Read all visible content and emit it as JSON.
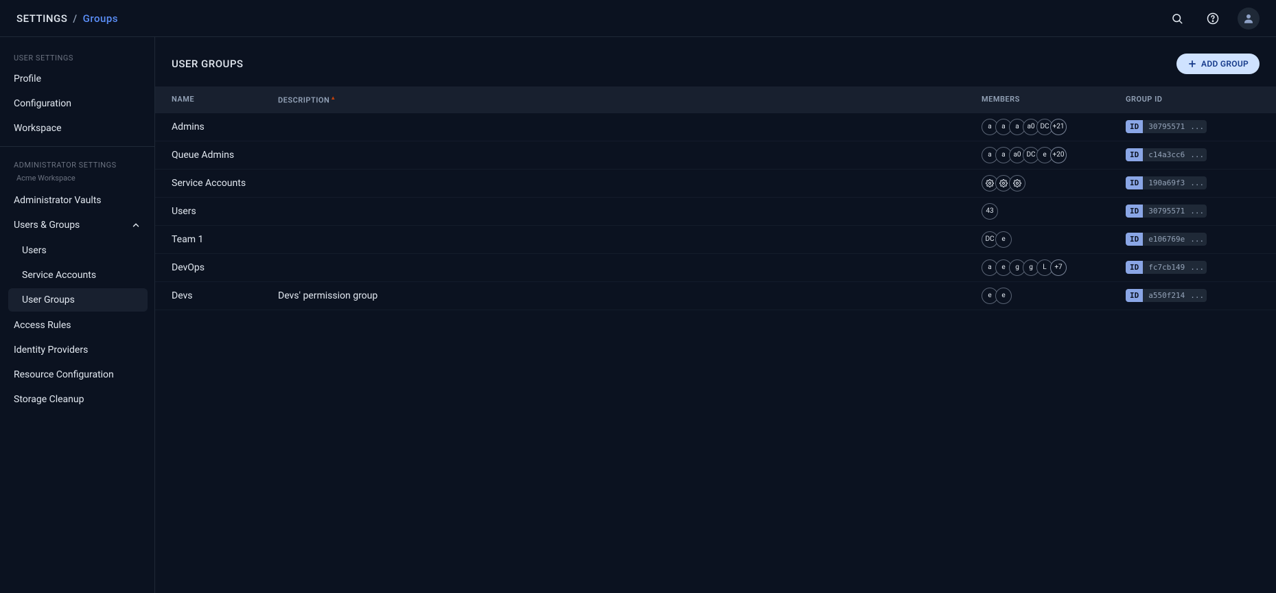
{
  "breadcrumb": {
    "root": "SETTINGS",
    "separator": "/",
    "current": "Groups"
  },
  "topbar": {
    "search_icon": "search",
    "help_icon": "help",
    "avatar_icon": "user"
  },
  "sidebar": {
    "user_settings_label": "USER SETTINGS",
    "user_settings_items": [
      {
        "label": "Profile"
      },
      {
        "label": "Configuration"
      },
      {
        "label": "Workspace"
      }
    ],
    "admin_settings_label": "ADMINISTRATOR SETTINGS",
    "workspace_name": "Acme Workspace",
    "admin_items": [
      {
        "label": "Administrator Vaults",
        "expanded": false,
        "sub": null
      },
      {
        "label": "Users & Groups",
        "expanded": true,
        "sub": [
          {
            "label": "Users",
            "active": false
          },
          {
            "label": "Service Accounts",
            "active": false
          },
          {
            "label": "User Groups",
            "active": true
          }
        ]
      },
      {
        "label": "Access Rules",
        "expanded": false,
        "sub": null
      },
      {
        "label": "Identity Providers",
        "expanded": false,
        "sub": null
      },
      {
        "label": "Resource Configuration",
        "expanded": false,
        "sub": null
      },
      {
        "label": "Storage Cleanup",
        "expanded": false,
        "sub": null
      }
    ]
  },
  "page": {
    "title": "USER GROUPS",
    "add_button": "ADD GROUP"
  },
  "table": {
    "columns": {
      "name": "NAME",
      "description": "DESCRIPTION",
      "members": "MEMBERS",
      "group_id": "GROUP ID"
    },
    "id_badge_label": "ID",
    "ellipsis": "...",
    "rows": [
      {
        "name": "Admins",
        "description": "",
        "members": [
          {
            "type": "text",
            "label": "a"
          },
          {
            "type": "text",
            "label": "a"
          },
          {
            "type": "text",
            "label": "a"
          },
          {
            "type": "text",
            "label": "a0"
          },
          {
            "type": "text",
            "label": "DC"
          },
          {
            "type": "more",
            "label": "+21"
          }
        ],
        "group_id": "30795571"
      },
      {
        "name": "Queue Admins",
        "description": "",
        "members": [
          {
            "type": "text",
            "label": "a"
          },
          {
            "type": "text",
            "label": "a"
          },
          {
            "type": "text",
            "label": "a0"
          },
          {
            "type": "text",
            "label": "DC"
          },
          {
            "type": "text",
            "label": "e"
          },
          {
            "type": "more",
            "label": "+20"
          }
        ],
        "group_id": "c14a3cc6"
      },
      {
        "name": "Service Accounts",
        "description": "",
        "members": [
          {
            "type": "icon",
            "label": "gear"
          },
          {
            "type": "icon",
            "label": "gear"
          },
          {
            "type": "icon",
            "label": "gear"
          }
        ],
        "group_id": "190a69f3"
      },
      {
        "name": "Users",
        "description": "",
        "members": [
          {
            "type": "text",
            "label": "43"
          }
        ],
        "group_id": "30795571"
      },
      {
        "name": "Team 1",
        "description": "",
        "members": [
          {
            "type": "text",
            "label": "DC"
          },
          {
            "type": "text",
            "label": "e"
          }
        ],
        "group_id": "e106769e"
      },
      {
        "name": "DevOps",
        "description": "",
        "members": [
          {
            "type": "text",
            "label": "a"
          },
          {
            "type": "text",
            "label": "e"
          },
          {
            "type": "text",
            "label": "g"
          },
          {
            "type": "text",
            "label": "g"
          },
          {
            "type": "text",
            "label": "L"
          },
          {
            "type": "more",
            "label": "+7"
          }
        ],
        "group_id": "fc7cb149"
      },
      {
        "name": "Devs",
        "description": "Devs' permission group",
        "members": [
          {
            "type": "text",
            "label": "e"
          },
          {
            "type": "text",
            "label": "e"
          }
        ],
        "group_id": "a550f214"
      }
    ]
  }
}
